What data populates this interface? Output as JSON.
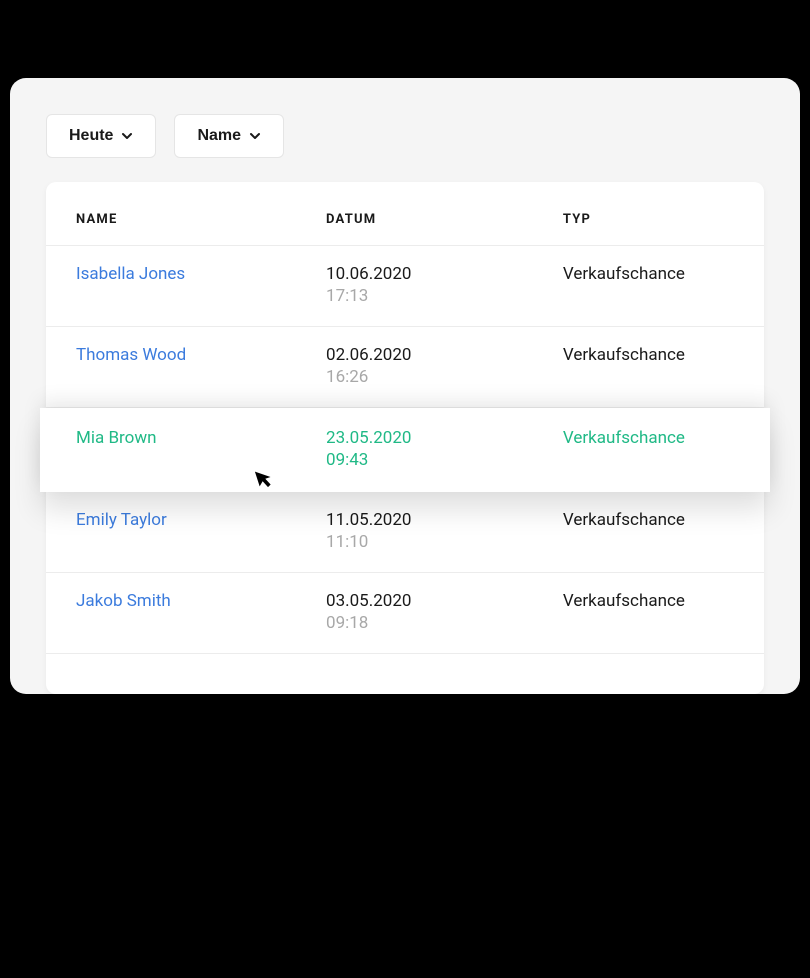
{
  "filters": {
    "date_label": "Heute",
    "sort_label": "Name"
  },
  "table": {
    "headers": {
      "name": "NAME",
      "date": "DATUM",
      "type": "TYP"
    },
    "rows": [
      {
        "name": "Isabella  Jones",
        "date": "10.06.2020",
        "time": "17:13",
        "type": "Verkaufschance",
        "highlighted": false
      },
      {
        "name": "Thomas  Wood",
        "date": "02.06.2020",
        "time": "16:26",
        "type": "Verkaufschance",
        "highlighted": false
      },
      {
        "name": "Mia  Brown",
        "date": "23.05.2020",
        "time": "09:43",
        "type": "Verkaufschance",
        "highlighted": true
      },
      {
        "name": "Emily  Taylor",
        "date": "11.05.2020",
        "time": "11:10",
        "type": "Verkaufschance",
        "highlighted": false
      },
      {
        "name": "Jakob Smith",
        "date": "03.05.2020",
        "time": "09:18",
        "type": "Verkaufschance",
        "highlighted": false
      }
    ]
  }
}
